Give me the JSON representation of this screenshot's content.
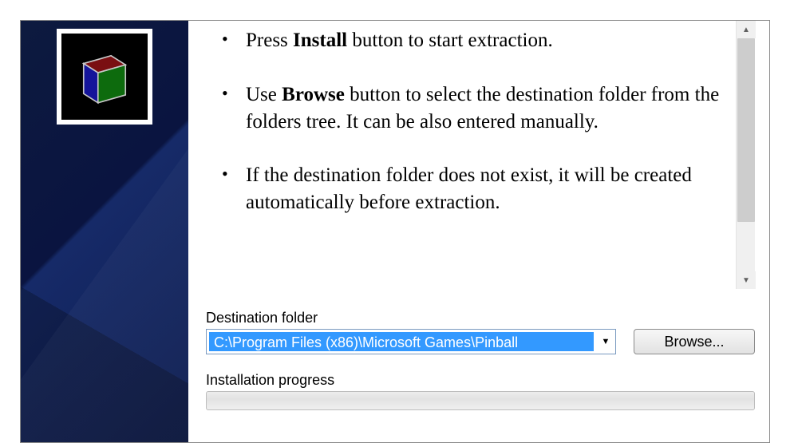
{
  "icon": {
    "semantic": "package-box-icon"
  },
  "instructions": {
    "items": [
      {
        "pre": "Press ",
        "bold": "Install",
        "post": " button to start extraction."
      },
      {
        "pre": "Use ",
        "bold": "Browse",
        "post": " button to select the destination folder from the folders tree. It can be also entered manually."
      },
      {
        "pre": "",
        "bold": "",
        "post": "If the destination folder does not exist, it will be created automatically before extraction."
      }
    ]
  },
  "destination": {
    "label": "Destination folder",
    "value": "C:\\Program Files (x86)\\Microsoft Games\\Pinball",
    "browse_label": "Browse..."
  },
  "progress": {
    "label": "Installation progress",
    "percent": 0
  }
}
